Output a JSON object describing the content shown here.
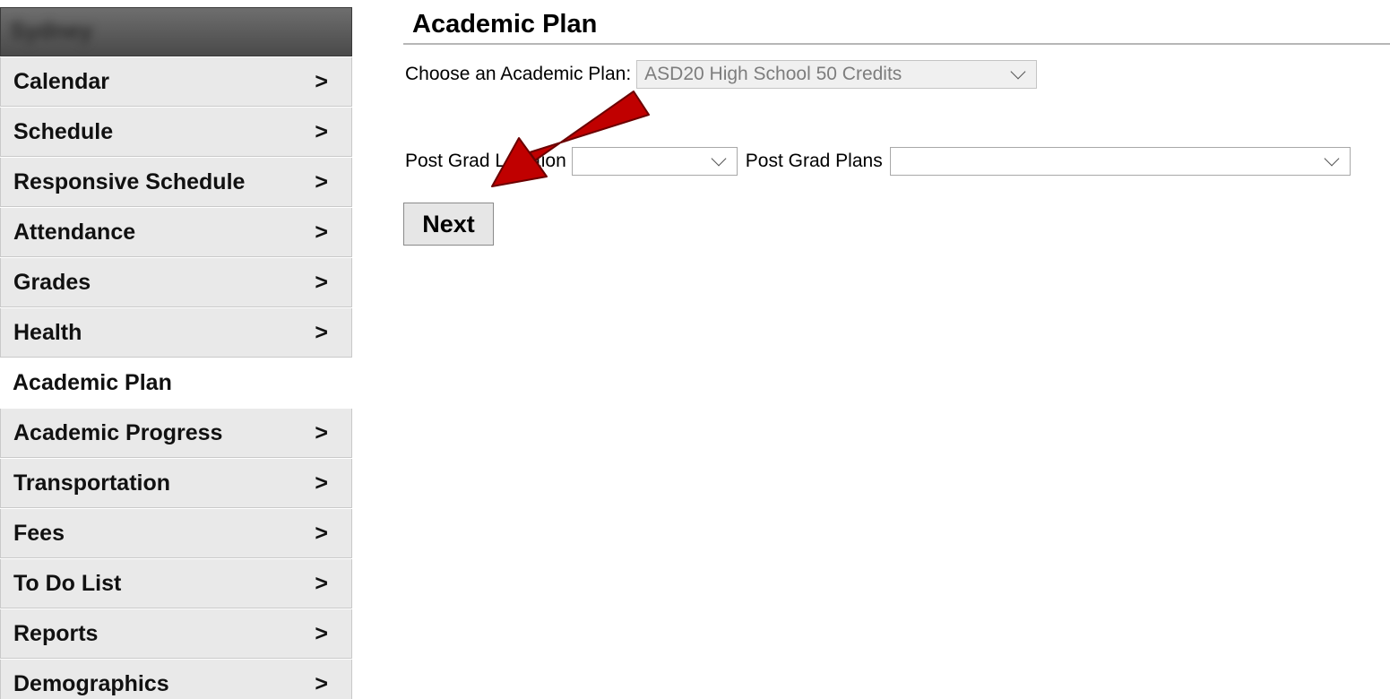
{
  "sidebar": {
    "student_name": "Sydney",
    "items": [
      {
        "label": "Calendar",
        "chevron": ">"
      },
      {
        "label": "Schedule",
        "chevron": ">"
      },
      {
        "label": "Responsive Schedule",
        "chevron": ">"
      },
      {
        "label": "Attendance",
        "chevron": ">"
      },
      {
        "label": "Grades",
        "chevron": ">"
      },
      {
        "label": "Health",
        "chevron": ">"
      },
      {
        "label": "Academic Plan",
        "chevron": ""
      },
      {
        "label": "Academic Progress",
        "chevron": ">"
      },
      {
        "label": "Transportation",
        "chevron": ">"
      },
      {
        "label": "Fees",
        "chevron": ">"
      },
      {
        "label": "To Do List",
        "chevron": ">"
      },
      {
        "label": "Reports",
        "chevron": ">"
      },
      {
        "label": "Demographics",
        "chevron": ">"
      }
    ]
  },
  "main": {
    "title": "Academic Plan",
    "plan_label": "Choose an Academic Plan:",
    "plan_value": "ASD20 High School 50 Credits",
    "post_grad_location_label": "Post Grad Location",
    "post_grad_location_value": "",
    "post_grad_plans_label": "Post Grad Plans",
    "post_grad_plans_value": "",
    "next_label": "Next"
  },
  "annotation": {
    "arrow_color": "#c00000",
    "icon": "red-arrow"
  }
}
